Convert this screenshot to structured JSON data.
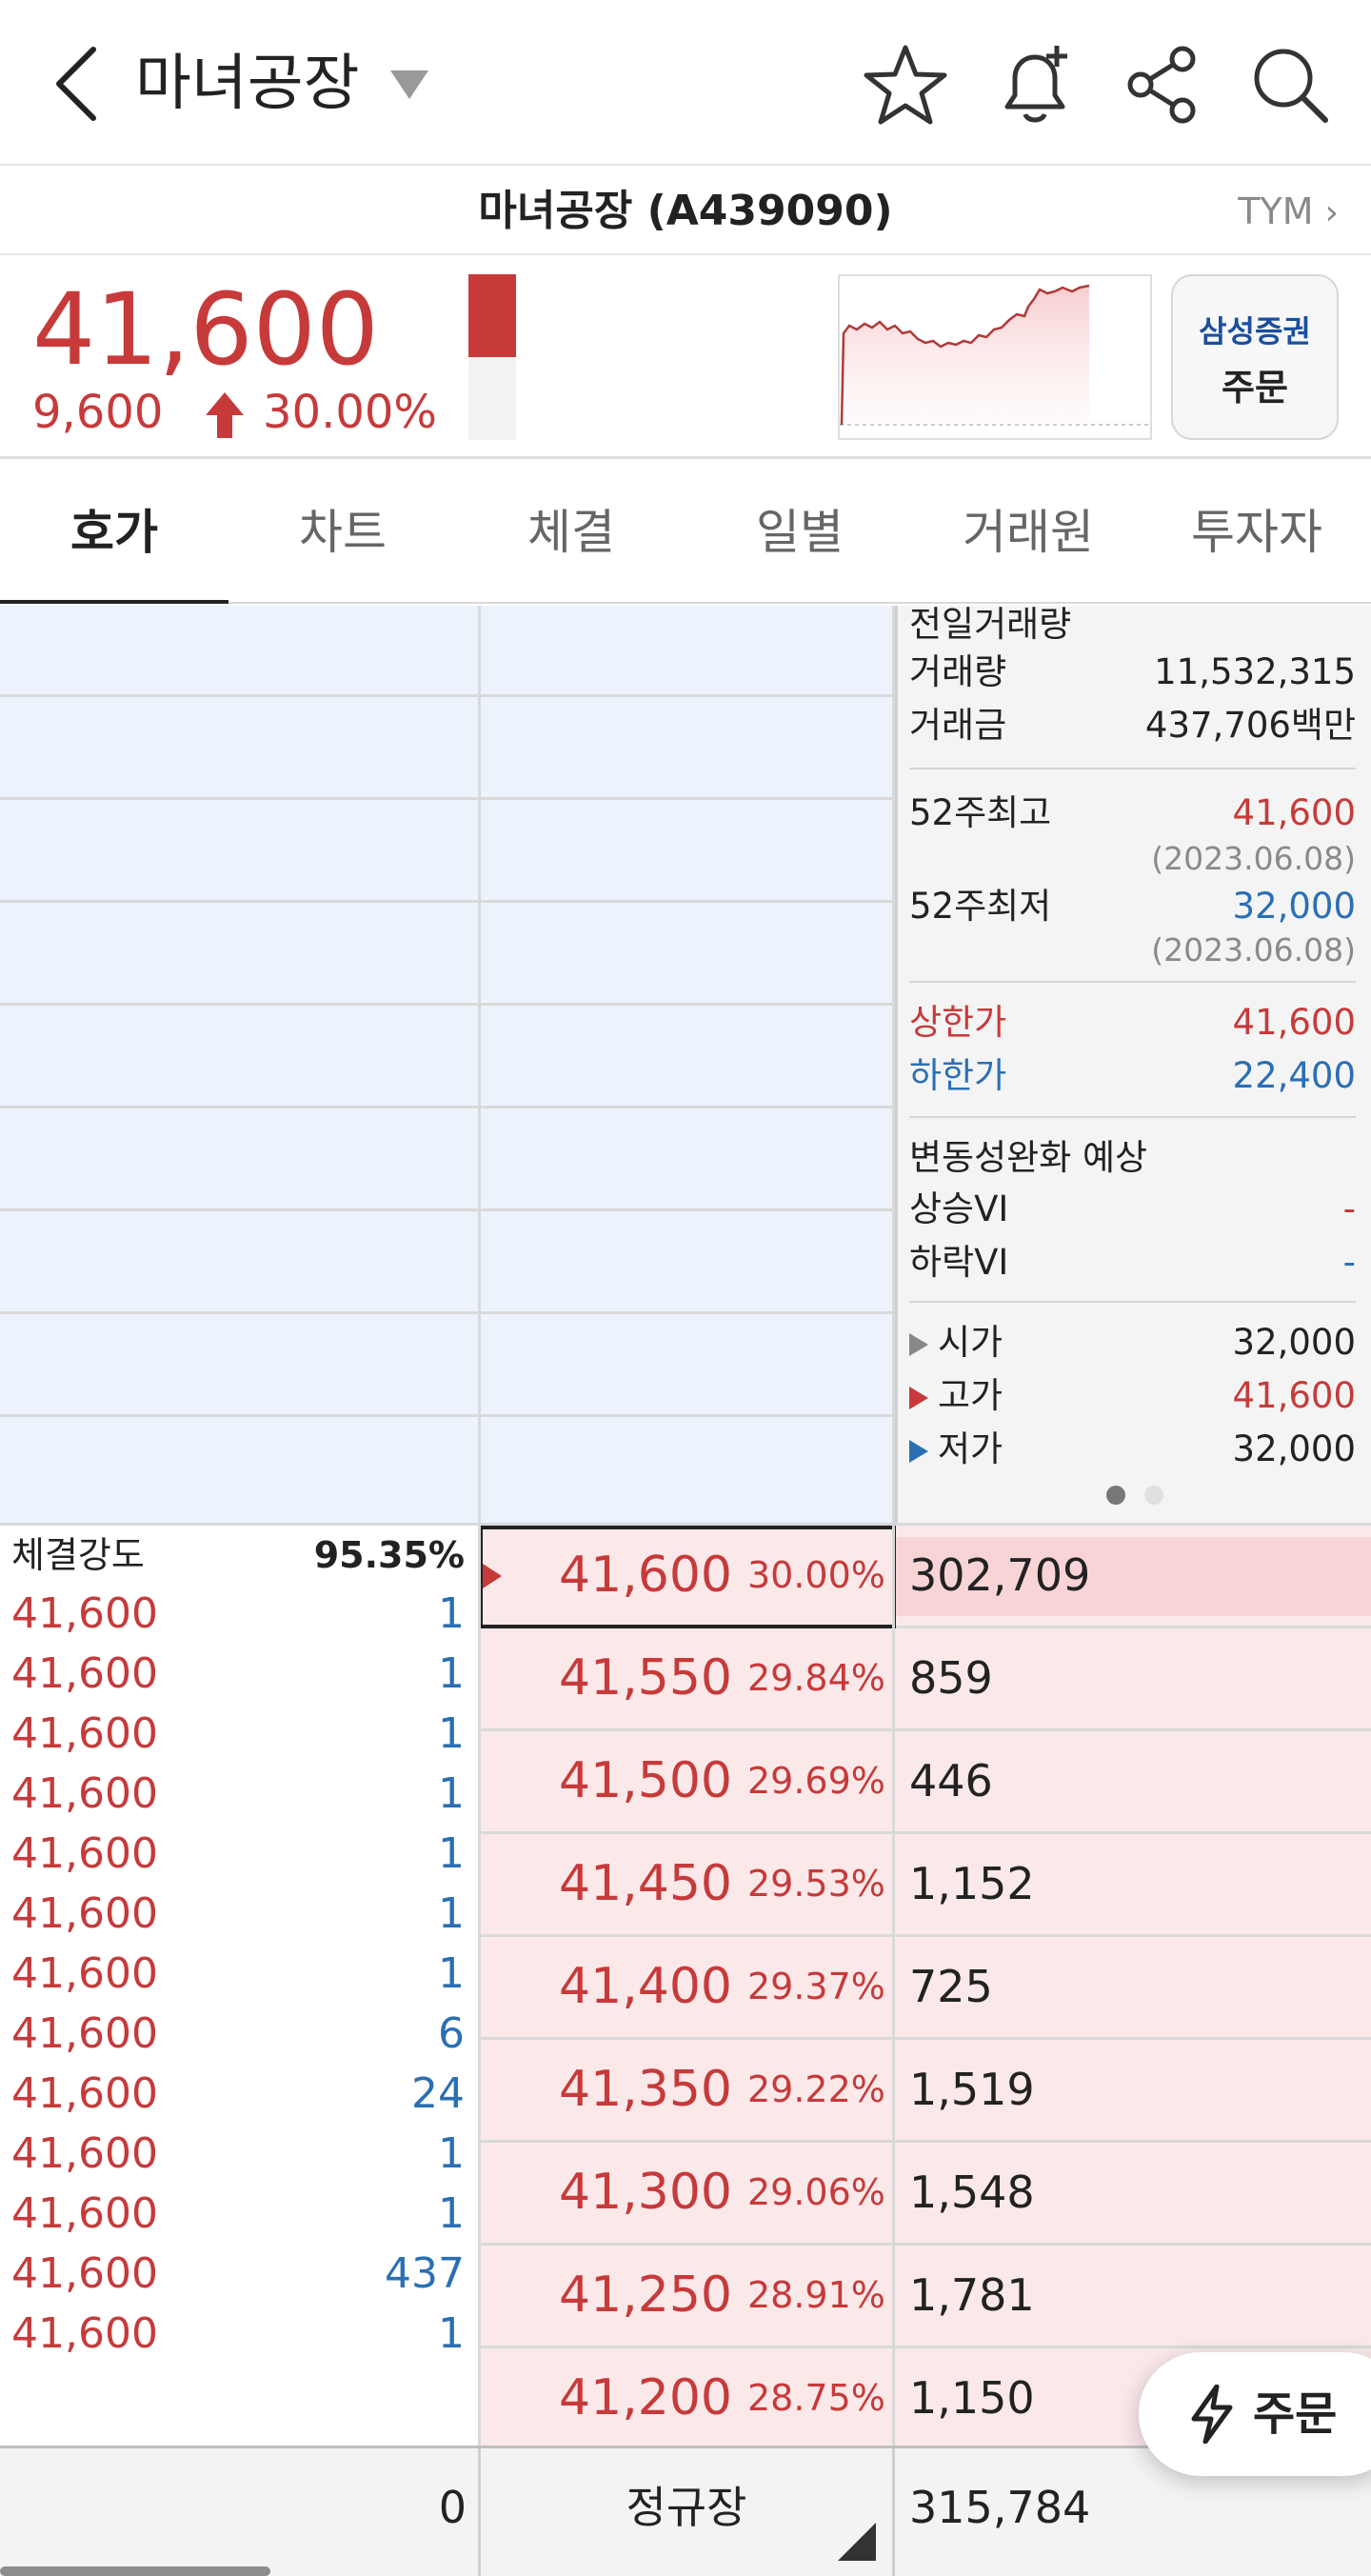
{
  "header": {
    "title": "마녀공장",
    "icons": [
      "back-icon",
      "dropdown-caret-icon",
      "star-icon",
      "bell-plus-icon",
      "share-icon",
      "search-icon"
    ]
  },
  "subheader": {
    "stock_name": "마녀공장 (A439090)",
    "related": "TYM"
  },
  "price": {
    "current": "41,600",
    "change": "9,600",
    "change_pct": "30.00%",
    "strength_fill": 0.5
  },
  "order_button": {
    "broker": "삼성증권",
    "label": "주문"
  },
  "tabs": [
    "호가",
    "차트",
    "체결",
    "일별",
    "거래원",
    "투자자"
  ],
  "info": {
    "prev_volume_label": "전일거래량",
    "volume_label": "거래량",
    "volume": "11,532,315",
    "amount_label": "거래금",
    "amount": "437,706백만",
    "high52_label": "52주최고",
    "high52": "41,600",
    "high52_date": "(2023.06.08)",
    "low52_label": "52주최저",
    "low52": "32,000",
    "low52_date": "(2023.06.08)",
    "upper_label": "상한가",
    "upper": "41,600",
    "lower_label": "하한가",
    "lower": "22,400",
    "vi_label": "변동성완화 예상",
    "vi_up_label": "상승VI",
    "vi_up": "-",
    "vi_down_label": "하락VI",
    "vi_down": "-",
    "open_label": "시가",
    "open": "32,000",
    "high_label": "고가",
    "high": "41,600",
    "low_label": "저가",
    "low": "32,000"
  },
  "trades": {
    "strength_label": "체결강도",
    "strength": "95.35%",
    "rows": [
      {
        "price": "41,600",
        "qty": "1"
      },
      {
        "price": "41,600",
        "qty": "1"
      },
      {
        "price": "41,600",
        "qty": "1"
      },
      {
        "price": "41,600",
        "qty": "1"
      },
      {
        "price": "41,600",
        "qty": "1"
      },
      {
        "price": "41,600",
        "qty": "1"
      },
      {
        "price": "41,600",
        "qty": "1"
      },
      {
        "price": "41,600",
        "qty": "6"
      },
      {
        "price": "41,600",
        "qty": "24"
      },
      {
        "price": "41,600",
        "qty": "1"
      },
      {
        "price": "41,600",
        "qty": "1"
      },
      {
        "price": "41,600",
        "qty": "437"
      },
      {
        "price": "41,600",
        "qty": "1"
      }
    ]
  },
  "bids": [
    {
      "price": "41,600",
      "pct": "30.00%",
      "qty": "302,709"
    },
    {
      "price": "41,550",
      "pct": "29.84%",
      "qty": "859"
    },
    {
      "price": "41,500",
      "pct": "29.69%",
      "qty": "446"
    },
    {
      "price": "41,450",
      "pct": "29.53%",
      "qty": "1,152"
    },
    {
      "price": "41,400",
      "pct": "29.37%",
      "qty": "725"
    },
    {
      "price": "41,350",
      "pct": "29.22%",
      "qty": "1,519"
    },
    {
      "price": "41,300",
      "pct": "29.06%",
      "qty": "1,548"
    },
    {
      "price": "41,250",
      "pct": "28.91%",
      "qty": "1,781"
    },
    {
      "price": "41,200",
      "pct": "28.75%",
      "qty": "1,150"
    }
  ],
  "footer": {
    "ask_total": "0",
    "session": "정규장",
    "bid_total": "315,784"
  },
  "fab": {
    "label": "주문"
  },
  "colors": {
    "up": "#c73a3a",
    "down": "#2a6fb5",
    "ask_bg": "#ecf3fd",
    "bid_bg": "#fbe9ea"
  }
}
